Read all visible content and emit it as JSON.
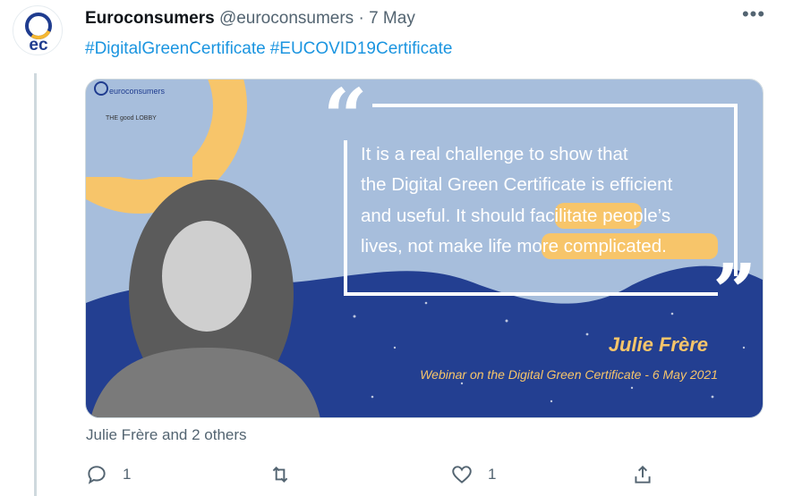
{
  "tweet": {
    "author_name": "Euroconsumers",
    "handle": "@euroconsumers",
    "separator": "·",
    "date": "7 May",
    "hashtags": [
      "#DigitalGreenCertificate",
      "#EUCOVID19Certificate"
    ],
    "avatar_text": "ec",
    "liked_by": "Julie Frère and 2 others",
    "reply_count": "1",
    "like_count": "1"
  },
  "image": {
    "logo_text": "euroconsumers",
    "partner_text": "THE good LOBBY",
    "quote_lines": [
      "It is a real challenge to show that",
      "the Digital Green Certificate is efficient",
      "and useful. It should facilitate people’s",
      "lives, not make life more complicated."
    ],
    "speaker": "Julie Frère",
    "event": "Webinar on the Digital Green Certificate - 6 May 2021"
  },
  "colors": {
    "link": "#1b95e0",
    "muted": "#536471",
    "card_bg": "#a7bedc",
    "wave_blue": "#233f91",
    "accent_yellow": "#f7c56a"
  },
  "icons": {
    "reply": "reply-icon",
    "retweet": "retweet-icon",
    "like": "like-icon",
    "share": "share-icon",
    "more": "more-icon"
  }
}
